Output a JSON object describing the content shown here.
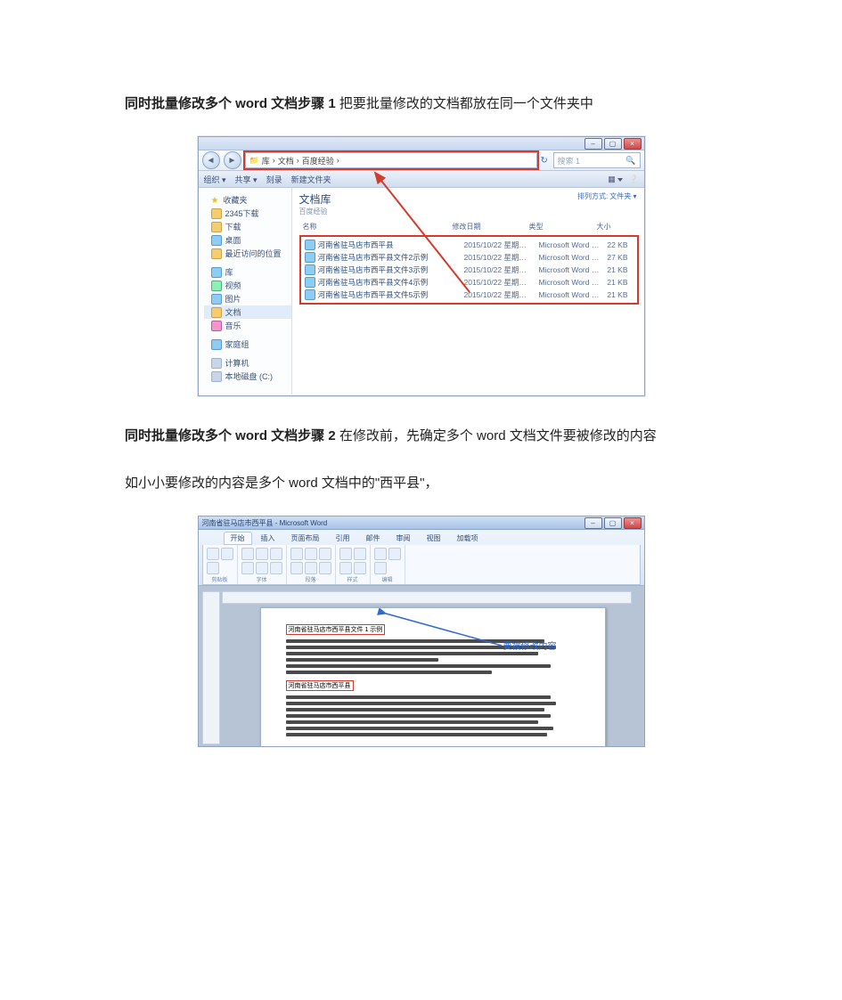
{
  "paragraphs": {
    "p1_bold": "同时批量修改多个 word 文档步骤 1",
    "p1_rest": " 把要批量修改的文档都放在同一个文件夹中",
    "p2_bold": "同时批量修改多个 word 文档步骤 2",
    "p2_rest": " 在修改前，先确定多个 word 文档文件要被修改的内容",
    "p3": "如小小要修改的内容是多个 word 文档中的\"西平县\"，"
  },
  "explorer": {
    "nav_back_glyph": "◄",
    "nav_fwd_glyph": "►",
    "breadcrumb": [
      "库",
      "文档",
      "百度经验"
    ],
    "search_placeholder": "搜索 1",
    "toolbar": {
      "organize": "组织 ▾",
      "share": "共享 ▾",
      "burn": "刻录",
      "newfolder": "新建文件夹"
    },
    "sort_label_prefix": "排列方式:",
    "sort_value": "文件夹 ▾",
    "lib_title": "文档库",
    "lib_subtitle": "百度经验",
    "nav": {
      "favorites": "收藏夹",
      "fav_items": [
        "2345下载",
        "下载",
        "桌面",
        "最近访问的位置"
      ],
      "libraries": "库",
      "lib_items": [
        {
          "label": "视频",
          "icon": "video"
        },
        {
          "label": "图片",
          "icon": "blue"
        },
        {
          "label": "文档",
          "icon": "folder",
          "selected": true
        },
        {
          "label": "音乐",
          "icon": "music"
        }
      ],
      "homegroup": "家庭组",
      "computer": "计算机",
      "drive": "本地磁盘 (C:)"
    },
    "columns": {
      "name": "名称",
      "date": "修改日期",
      "type": "类型",
      "size": "大小"
    },
    "files": [
      {
        "name": "河南省驻马店市西平县",
        "date": "2015/10/22 星期…",
        "type": "Microsoft Word …",
        "size": "22 KB"
      },
      {
        "name": "河南省驻马店市西平县文件2示例",
        "date": "2015/10/22 星期…",
        "type": "Microsoft Word …",
        "size": "27 KB"
      },
      {
        "name": "河南省驻马店市西平县文件3示例",
        "date": "2015/10/22 星期…",
        "type": "Microsoft Word …",
        "size": "21 KB"
      },
      {
        "name": "河南省驻马店市西平县文件4示例",
        "date": "2015/10/22 星期…",
        "type": "Microsoft Word …",
        "size": "21 KB"
      },
      {
        "name": "河南省驻马店市西平县文件5示例",
        "date": "2015/10/22 星期…",
        "type": "Microsoft Word …",
        "size": "21 KB"
      }
    ]
  },
  "word": {
    "title": "河南省驻马店市西平县 - Microsoft Word",
    "tabs": [
      "开始",
      "插入",
      "页面布局",
      "引用",
      "邮件",
      "审阅",
      "视图",
      "加载项"
    ],
    "groups": [
      "剪贴板",
      "字体",
      "段落",
      "样式",
      "编辑"
    ],
    "doc_heading1": "河南省驻马店市西平县文件 1 示例",
    "doc_heading2": "河南省驻马店市西平县",
    "callout": "要被修改内容"
  }
}
